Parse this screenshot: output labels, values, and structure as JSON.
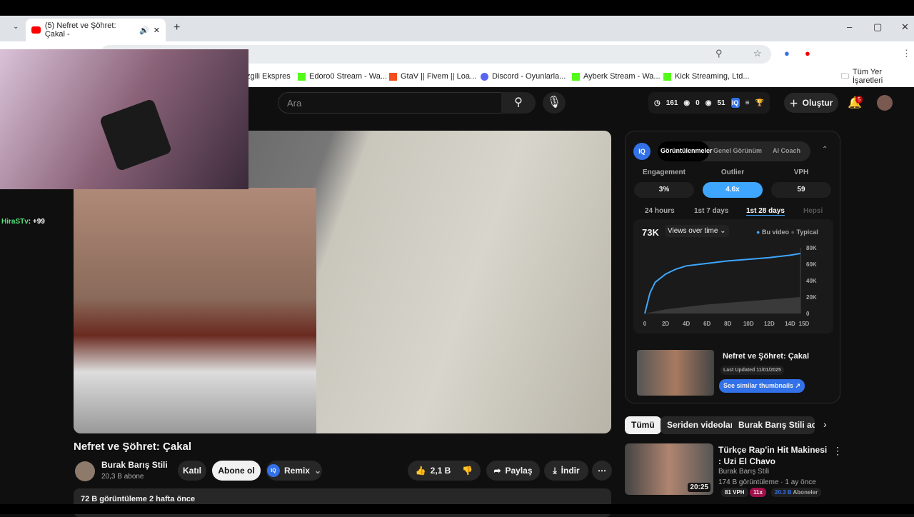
{
  "browser": {
    "tab_title": "(5) Nefret ve Şöhret: Çakal -",
    "bookmarks": [
      "zgili Ekspres",
      "Edoro0 Stream - Wa...",
      "GtaV || Fivem || Loa...",
      "Discord - Oyunlarla...",
      "Ayberk Stream - Wa...",
      "Kick Streaming, Ltd..."
    ],
    "all_bookmarks": "Tüm Yer İşaretleri"
  },
  "overlay": {
    "chat_user": "HiraSTv",
    "chat_msg": ": +99"
  },
  "header": {
    "search_placeholder": "Ara",
    "stats": [
      "161",
      "0",
      "51"
    ],
    "create": "Oluştur",
    "notif_count": "5"
  },
  "video": {
    "title": "Nefret ve Şöhret: Çakal",
    "channel": "Burak Barış Stili",
    "subs": "20,3 B abone",
    "join": "Katıl",
    "subscribe": "Abone ol",
    "remix": "Remix",
    "likes": "2,1 B",
    "share": "Paylaş",
    "download": "İndir",
    "desc": "72 B görüntüleme  2 hafta önce"
  },
  "panel": {
    "tabs": [
      "Görüntülenmeler",
      "Genel Görünüm",
      "AI Coach"
    ],
    "metrics": [
      {
        "label": "Engagement",
        "value": "3%"
      },
      {
        "label": "Outlier",
        "value": "4.6x"
      },
      {
        "label": "VPH",
        "value": "59"
      }
    ],
    "ranges": [
      "24 hours",
      "1st 7 days",
      "1st 28 days",
      "Hepsi"
    ],
    "total": "73K",
    "dropdown": "Views over time",
    "legend": [
      "Bu video",
      "Typical"
    ],
    "thumb_title": "Nefret ve Şöhret: Çakal",
    "updated": "Last Updated 11/01/2025",
    "similar": "See similar thumbnails ↗"
  },
  "chart_data": {
    "type": "line",
    "x_ticks": [
      "0",
      "2D",
      "4D",
      "6D",
      "8D",
      "10D",
      "12D",
      "14D",
      "15D"
    ],
    "y_ticks": [
      "0",
      "20K",
      "40K",
      "60K",
      "80K"
    ],
    "ylim": [
      0,
      80000
    ],
    "xlim": [
      0,
      15
    ],
    "series": [
      {
        "name": "Bu video",
        "color": "#3ea6ff",
        "x": [
          0,
          0.5,
          1,
          2,
          3,
          4,
          6,
          8,
          10,
          12,
          14,
          15
        ],
        "y": [
          0,
          25000,
          38000,
          48000,
          54000,
          58000,
          61000,
          64000,
          66000,
          68000,
          71000,
          73000
        ]
      },
      {
        "name": "Typical",
        "color": "#555555",
        "x": [
          0,
          2,
          4,
          6,
          8,
          10,
          12,
          14,
          15
        ],
        "y": [
          0,
          5000,
          8000,
          11000,
          13000,
          15000,
          17000,
          19000,
          20000
        ]
      }
    ]
  },
  "chips": [
    "Tümü",
    "Seriden videolar",
    "Burak Barış Stili adlı y"
  ],
  "related": {
    "title": "Türkçe Rap'in Hit Makinesi : Uzi El Chavo",
    "channel": "Burak Barış Stili",
    "meta": "174 B görüntüleme · 1 ay önce",
    "duration": "20:25",
    "vph": "81 VPH",
    "outlier": "11x",
    "subs_num": "20.3 B",
    "subs_label": "Aboneler"
  }
}
